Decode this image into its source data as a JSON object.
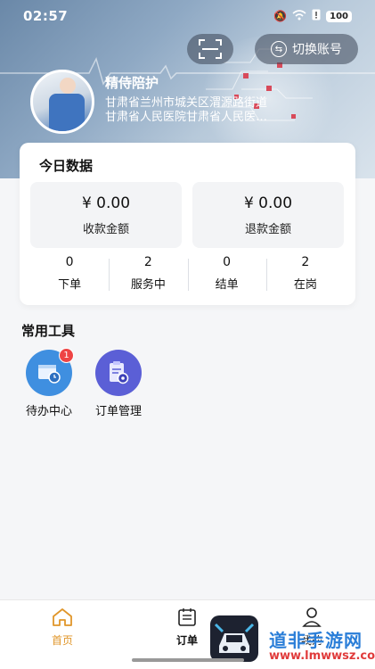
{
  "status_bar": {
    "time": "02:57",
    "battery": "100"
  },
  "header": {
    "switch_account_label": "切换账号",
    "profile_name": "精侍陪护",
    "profile_address": "甘肃省兰州市城关区渭源路街道",
    "profile_hospital": "甘肃省人民医院甘肃省人民医…"
  },
  "today": {
    "title": "今日数据",
    "income": {
      "value": "¥ 0.00",
      "label": "收款金额"
    },
    "refund": {
      "value": "¥ 0.00",
      "label": "退款金额"
    },
    "stats": [
      {
        "num": "0",
        "label": "下单"
      },
      {
        "num": "2",
        "label": "服务中"
      },
      {
        "num": "0",
        "label": "结单"
      },
      {
        "num": "2",
        "label": "在岗"
      }
    ]
  },
  "tools": {
    "title": "常用工具",
    "items": [
      {
        "label": "待办中心",
        "badge": "1",
        "icon": "todo-clock-icon"
      },
      {
        "label": "订单管理",
        "icon": "order-clipboard-icon"
      }
    ]
  },
  "nav": {
    "items": [
      {
        "label": "首页",
        "icon": "home-icon"
      },
      {
        "label": "订单",
        "icon": "order-icon"
      },
      {
        "label": "我的",
        "icon": "user-icon"
      }
    ],
    "active_color": "#e0962a"
  },
  "watermark": {
    "text": "道非手游网",
    "url": "www.lmwwsz.com"
  }
}
